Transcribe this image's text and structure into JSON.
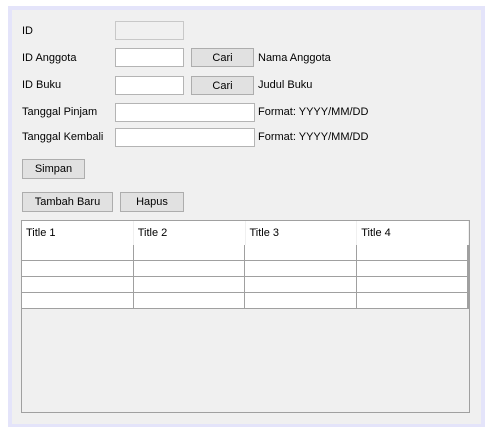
{
  "form": {
    "id": {
      "label": "ID",
      "value": ""
    },
    "id_anggota": {
      "label": "ID Anggota",
      "value": "",
      "button": "Cari",
      "info": "Nama Anggota"
    },
    "id_buku": {
      "label": "ID Buku",
      "value": "",
      "button": "Cari",
      "info": "Judul Buku"
    },
    "tanggal_pinjam": {
      "label": "Tanggal Pinjam",
      "value": "",
      "hint": "Format: YYYY/MM/DD"
    },
    "tanggal_kembali": {
      "label": "Tanggal Kembali",
      "value": "",
      "hint": "Format: YYYY/MM/DD"
    }
  },
  "buttons": {
    "simpan": "Simpan",
    "tambah_baru": "Tambah Baru",
    "hapus": "Hapus"
  },
  "table": {
    "columns": [
      "Title 1",
      "Title 2",
      "Title 3",
      "Title 4"
    ],
    "rows": [
      [
        "",
        "",
        "",
        ""
      ],
      [
        "",
        "",
        "",
        ""
      ],
      [
        "",
        "",
        "",
        ""
      ],
      [
        "",
        "",
        "",
        ""
      ]
    ]
  }
}
